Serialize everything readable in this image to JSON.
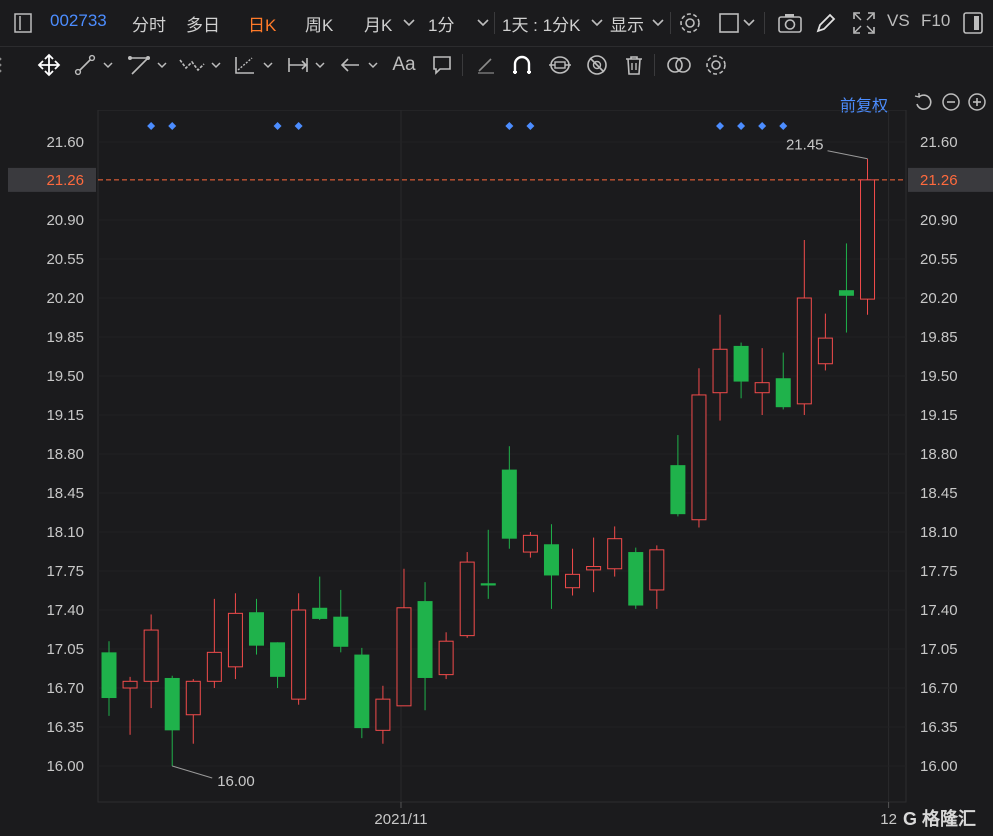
{
  "header": {
    "code": "002733",
    "tabs": [
      "分时",
      "多日",
      "日K",
      "周K",
      "月K",
      "1分"
    ],
    "active_tab": "日K",
    "period_select": "1天 : 1分K",
    "display_label": "显示",
    "vs_label": "VS",
    "f10_label": "F10"
  },
  "toolbar": {
    "text_tool_label": "Aa"
  },
  "fuquan_label": "前复权",
  "colors": {
    "up": "#f24b4b",
    "down": "#1fb24b",
    "accent": "#4c8dff",
    "current": "#ff6a3d"
  },
  "chart_data": {
    "type": "candlestick",
    "x_labels": [
      {
        "index": 14,
        "label": "2021/11"
      },
      {
        "index": 37,
        "label": "12"
      }
    ],
    "ylim": [
      15.7,
      21.85
    ],
    "yticks": [
      21.6,
      20.9,
      20.55,
      20.2,
      19.85,
      19.5,
      19.15,
      18.8,
      18.45,
      18.1,
      17.75,
      17.4,
      17.05,
      16.7,
      16.35,
      16.0
    ],
    "ytick_labels": [
      "21.60",
      "20.90",
      "20.55",
      "20.20",
      "19.85",
      "19.50",
      "19.15",
      "18.80",
      "18.45",
      "18.10",
      "17.75",
      "17.40",
      "17.05",
      "16.70",
      "16.35",
      "16.00"
    ],
    "current_price": 21.26,
    "current_price_label": "21.26",
    "max_label": {
      "index": 36,
      "value": 21.45,
      "text": "21.45"
    },
    "min_label": {
      "index": 3,
      "value": 16.0,
      "text": "16.00"
    },
    "marker_indices": [
      2,
      3,
      8,
      9,
      19,
      20,
      29,
      30,
      31,
      32
    ],
    "candles": [
      {
        "o": 17.02,
        "h": 17.12,
        "l": 16.45,
        "c": 16.61
      },
      {
        "o": 16.7,
        "h": 16.8,
        "l": 16.28,
        "c": 16.76
      },
      {
        "o": 16.76,
        "h": 17.36,
        "l": 16.52,
        "c": 17.22
      },
      {
        "o": 16.79,
        "h": 16.81,
        "l": 16.0,
        "c": 16.32
      },
      {
        "o": 16.46,
        "h": 16.78,
        "l": 16.2,
        "c": 16.76
      },
      {
        "o": 16.76,
        "h": 17.5,
        "l": 16.7,
        "c": 17.02
      },
      {
        "o": 16.89,
        "h": 17.55,
        "l": 16.78,
        "c": 17.37
      },
      {
        "o": 17.38,
        "h": 17.5,
        "l": 17.0,
        "c": 17.08
      },
      {
        "o": 17.11,
        "h": 17.11,
        "l": 16.7,
        "c": 16.8
      },
      {
        "o": 16.6,
        "h": 17.55,
        "l": 16.55,
        "c": 17.4
      },
      {
        "o": 17.42,
        "h": 17.7,
        "l": 17.31,
        "c": 17.32
      },
      {
        "o": 17.34,
        "h": 17.58,
        "l": 17.02,
        "c": 17.07
      },
      {
        "o": 17.0,
        "h": 17.06,
        "l": 16.25,
        "c": 16.34
      },
      {
        "o": 16.32,
        "h": 16.72,
        "l": 16.2,
        "c": 16.6
      },
      {
        "o": 16.54,
        "h": 17.77,
        "l": 16.54,
        "c": 17.42
      },
      {
        "o": 17.48,
        "h": 17.65,
        "l": 16.5,
        "c": 16.79
      },
      {
        "o": 16.82,
        "h": 17.2,
        "l": 16.78,
        "c": 17.12
      },
      {
        "o": 17.17,
        "h": 17.92,
        "l": 17.15,
        "c": 17.83
      },
      {
        "o": 17.64,
        "h": 18.12,
        "l": 17.5,
        "c": 17.62
      },
      {
        "o": 18.66,
        "h": 18.87,
        "l": 17.95,
        "c": 18.04
      },
      {
        "o": 17.92,
        "h": 18.1,
        "l": 17.87,
        "c": 18.07
      },
      {
        "o": 17.99,
        "h": 18.17,
        "l": 17.41,
        "c": 17.71
      },
      {
        "o": 17.6,
        "h": 17.95,
        "l": 17.53,
        "c": 17.72
      },
      {
        "o": 17.76,
        "h": 18.05,
        "l": 17.56,
        "c": 17.79
      },
      {
        "o": 17.77,
        "h": 18.15,
        "l": 17.7,
        "c": 18.04
      },
      {
        "o": 17.92,
        "h": 17.96,
        "l": 17.41,
        "c": 17.44
      },
      {
        "o": 17.58,
        "h": 17.98,
        "l": 17.41,
        "c": 17.94
      },
      {
        "o": 18.7,
        "h": 18.97,
        "l": 18.24,
        "c": 18.26
      },
      {
        "o": 18.21,
        "h": 19.57,
        "l": 18.14,
        "c": 19.33
      },
      {
        "o": 19.35,
        "h": 20.05,
        "l": 19.1,
        "c": 19.74
      },
      {
        "o": 19.77,
        "h": 19.8,
        "l": 19.3,
        "c": 19.45
      },
      {
        "o": 19.35,
        "h": 19.75,
        "l": 19.15,
        "c": 19.44
      },
      {
        "o": 19.48,
        "h": 19.71,
        "l": 19.2,
        "c": 19.22
      },
      {
        "o": 19.25,
        "h": 20.72,
        "l": 19.15,
        "c": 20.2
      },
      {
        "o": 19.61,
        "h": 20.06,
        "l": 19.55,
        "c": 19.84
      },
      {
        "o": 20.27,
        "h": 20.69,
        "l": 19.89,
        "c": 20.22
      },
      {
        "o": 20.19,
        "h": 21.45,
        "l": 20.05,
        "c": 21.26
      }
    ]
  }
}
